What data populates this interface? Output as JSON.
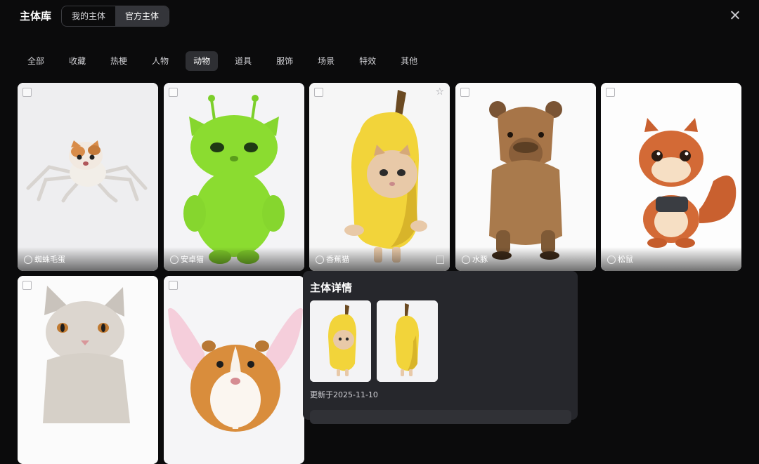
{
  "header": {
    "title": "主体库",
    "tabs": [
      "我的主体",
      "官方主体"
    ],
    "active_tab": "官方主体"
  },
  "categories": [
    "全部",
    "收藏",
    "热梗",
    "人物",
    "动物",
    "道具",
    "服饰",
    "场景",
    "特效",
    "其他"
  ],
  "active_category": "动物",
  "cards": [
    {
      "name": "蜘蛛毛蛋"
    },
    {
      "name": "安卓猫"
    },
    {
      "name": "香蕉猫"
    },
    {
      "name": "水豚"
    },
    {
      "name": "松鼠"
    },
    {
      "name": ""
    },
    {
      "name": ""
    }
  ],
  "detail": {
    "title": "主体详情",
    "updated": "更新于2025-11-10"
  },
  "colors": {
    "background": "#0b0b0c",
    "panel": "#26272c",
    "active_tab": "#34353a"
  }
}
